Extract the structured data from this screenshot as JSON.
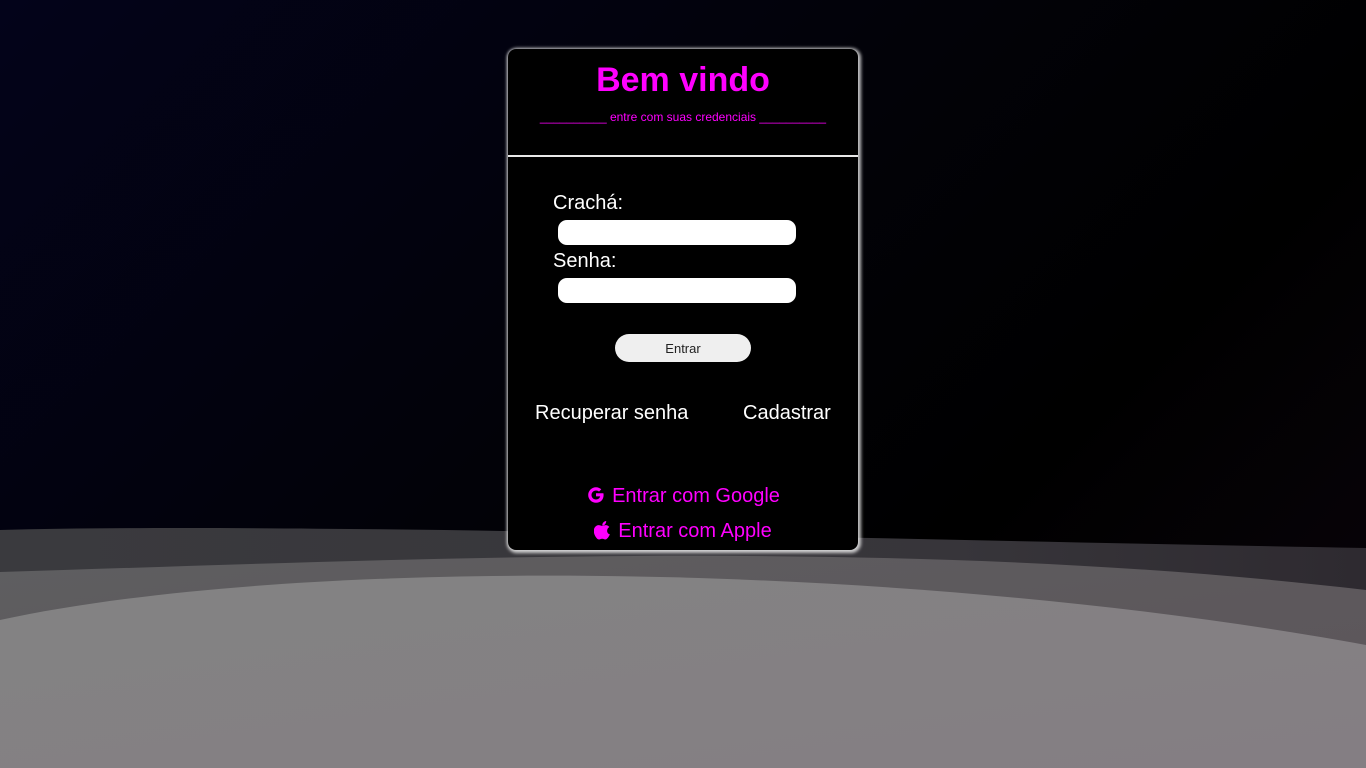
{
  "colors": {
    "accent": "#ff00ff",
    "card_background": "#000000",
    "text": "#ffffff",
    "input_background": "#ffffff",
    "button_background": "#efefef"
  },
  "login": {
    "title": "Bem vindo",
    "subtitle": "__________ entre com suas credenciais __________",
    "cracha_label": "Crachá:",
    "cracha_value": "",
    "senha_label": "Senha:",
    "senha_value": "",
    "submit_label": "Entrar",
    "recover_label": "Recuperar senha",
    "register_label": "Cadastrar",
    "google_label": "Entrar com Google",
    "google_icon": "google-icon",
    "apple_label": "Entrar com Apple",
    "apple_icon": "apple-icon"
  }
}
